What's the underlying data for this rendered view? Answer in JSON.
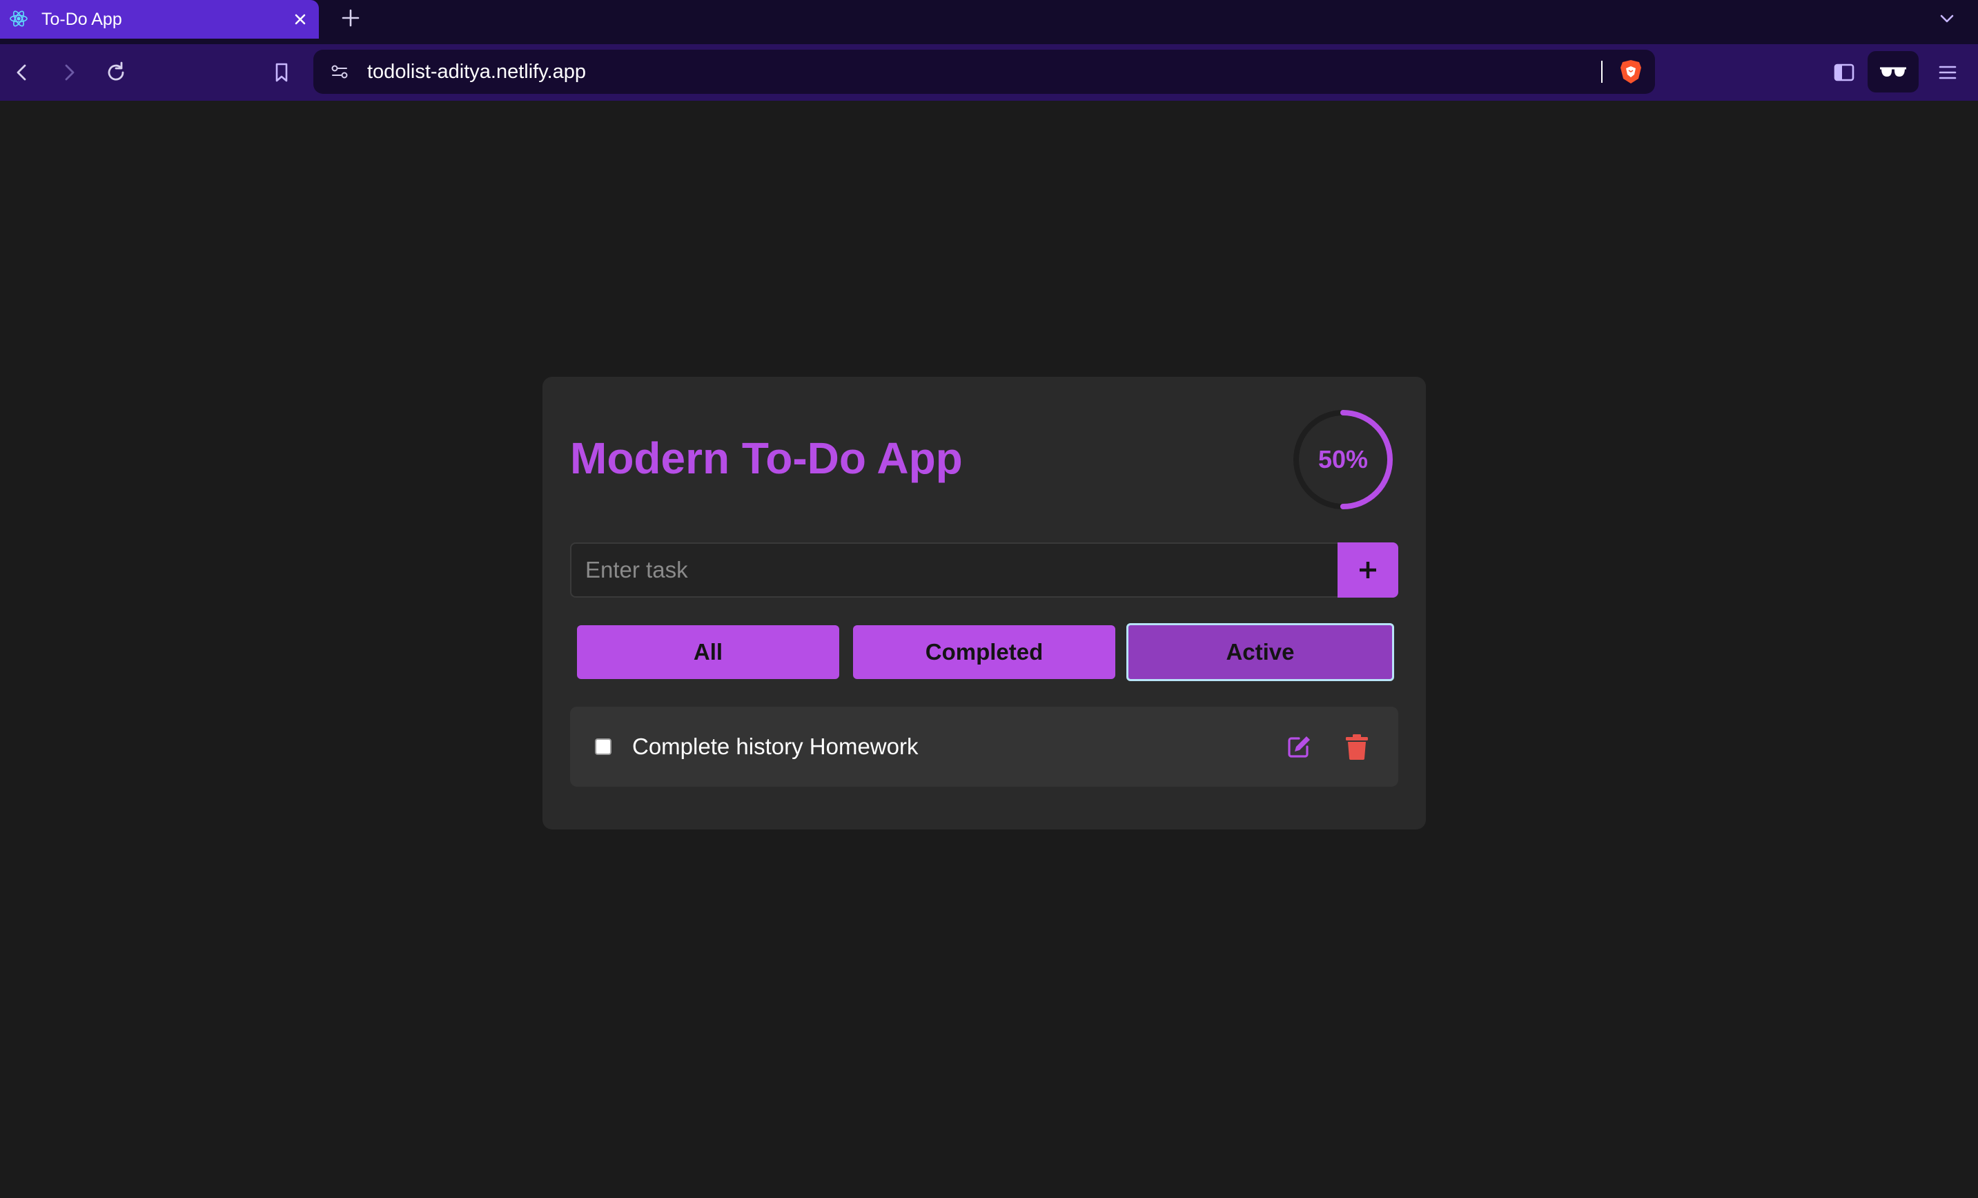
{
  "browser": {
    "tab_title": "To-Do App",
    "url": "todolist-aditya.netlify.app"
  },
  "app": {
    "title": "Modern To-Do App",
    "progress_percent": 50,
    "progress_label": "50%",
    "input": {
      "placeholder": "Enter task",
      "value": ""
    },
    "filters": [
      {
        "label": "All",
        "selected": false
      },
      {
        "label": "Completed",
        "selected": false
      },
      {
        "label": "Active",
        "selected": true
      }
    ],
    "tasks": [
      {
        "text": "Complete history Homework",
        "done": false
      }
    ]
  },
  "colors": {
    "accent": "#b64ee6",
    "accent_active": "#8f3dbd",
    "delete": "#e8524a",
    "page_bg": "#1b1b1b",
    "card_bg": "#2a2a2a"
  },
  "icons": [
    "react-favicon-icon",
    "close-icon",
    "plus-icon",
    "chevron-down-icon",
    "back-icon",
    "forward-icon",
    "reload-icon",
    "bookmark-icon",
    "site-settings-icon",
    "brave-shield-icon",
    "sidebar-icon",
    "reader-mode-icon",
    "menu-icon",
    "edit-icon",
    "trash-icon"
  ]
}
